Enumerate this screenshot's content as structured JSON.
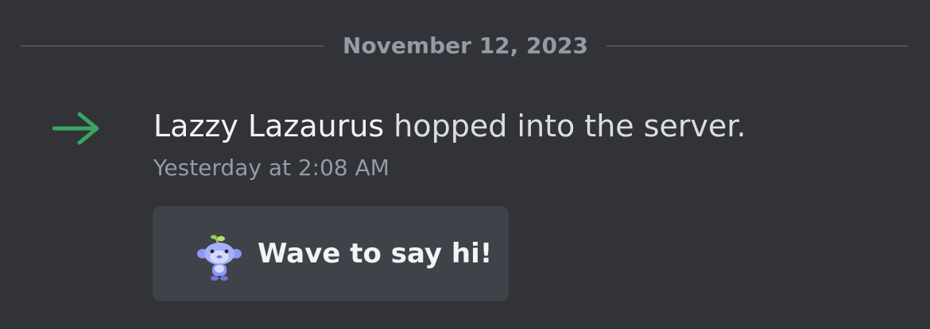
{
  "divider": {
    "date": "November 12, 2023"
  },
  "message": {
    "username": "Lazzy Lazaurus",
    "action": " hopped into the server.",
    "timestamp": "Yesterday at 2:08 AM"
  },
  "wave_button": {
    "label": "Wave to say hi!",
    "icon": "wumpus-icon"
  },
  "join_icon": "arrow-right-icon",
  "colors": {
    "background": "#313338",
    "join_arrow": "#3ba55d",
    "button_bg": "#404249",
    "muted_text": "#949ba4",
    "primary_text": "#f2f3f5"
  }
}
